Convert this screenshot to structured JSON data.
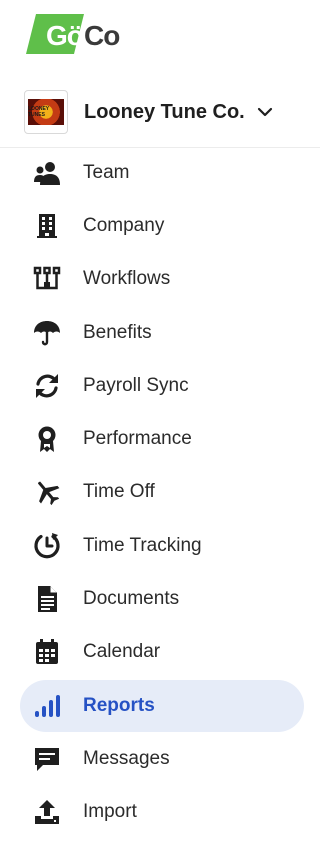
{
  "brand": {
    "logo_text": "Gö",
    "logo_suffix": "Co",
    "logo_color": "#5fbf4a"
  },
  "company": {
    "name": "Looney Tune Co.",
    "avatar_text": "LOONEY TUNES",
    "chevron_icon": "chevron-down-icon"
  },
  "nav": {
    "active_color": "#2652c4",
    "active_bg": "#e6ecf8",
    "items": [
      {
        "label": "Team",
        "icon": "team-icon"
      },
      {
        "label": "Company",
        "icon": "building-icon"
      },
      {
        "label": "Workflows",
        "icon": "workflow-icon"
      },
      {
        "label": "Benefits",
        "icon": "umbrella-icon"
      },
      {
        "label": "Payroll Sync",
        "icon": "sync-icon"
      },
      {
        "label": "Performance",
        "icon": "award-icon"
      },
      {
        "label": "Time Off",
        "icon": "airplane-icon"
      },
      {
        "label": "Time Tracking",
        "icon": "clock-icon"
      },
      {
        "label": "Documents",
        "icon": "document-icon"
      },
      {
        "label": "Calendar",
        "icon": "calendar-icon"
      },
      {
        "label": "Reports",
        "icon": "bar-chart-icon",
        "active": true
      },
      {
        "label": "Messages",
        "icon": "message-icon"
      },
      {
        "label": "Import",
        "icon": "upload-icon"
      }
    ]
  }
}
